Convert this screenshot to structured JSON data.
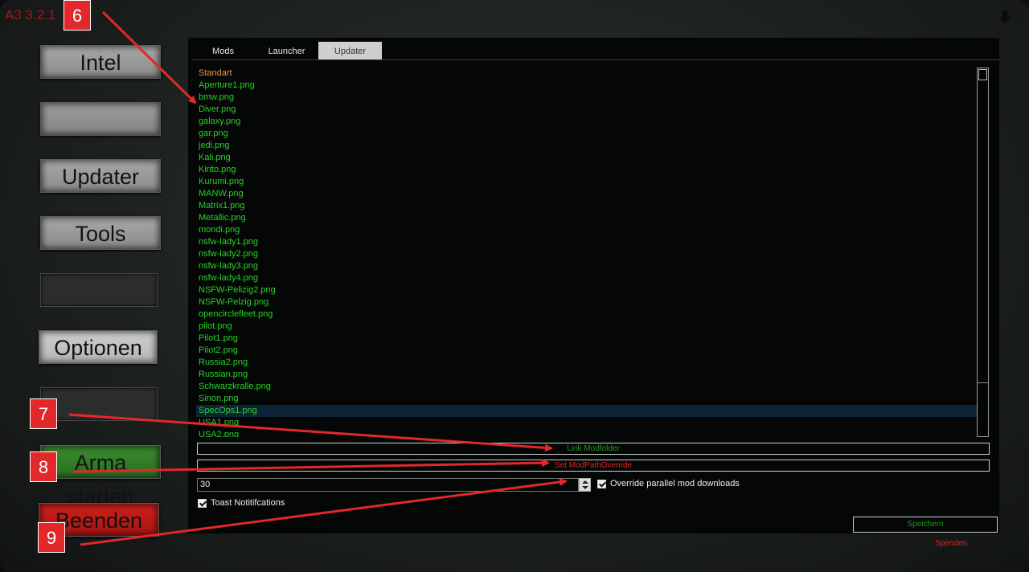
{
  "window": {
    "version": "A3 3.2.1"
  },
  "sidebar": {
    "buttons": [
      {
        "label": "Intel"
      },
      {
        "label": ""
      },
      {
        "label": "Updater"
      },
      {
        "label": "Tools"
      },
      {
        "label": ""
      },
      {
        "label": "Optionen"
      },
      {
        "label": ""
      },
      {
        "label": "Arma starten"
      },
      {
        "label": "Beenden"
      }
    ]
  },
  "tabs": [
    {
      "label": "Mods"
    },
    {
      "label": "Launcher"
    },
    {
      "label": "Updater"
    }
  ],
  "active_tab": "Updater",
  "file_list": [
    "Standart",
    "Aperture1.png",
    "bmw.png",
    "Diver.png",
    "galaxy.png",
    "gar.png",
    "jedi.png",
    "Kali.png",
    "Kirito.png",
    "Kurumi.png",
    "MANW.png",
    "Matrix1.png",
    "Metallic.png",
    "mondi.png",
    "nsfw-lady1.png",
    "nsfw-lady2.png",
    "nsfw-lady3.png",
    "nsfw-lady4.png",
    "NSFW-Pelizig2.png",
    "NSFW-Pelzig.png",
    "opencirclefleet.png",
    "pilot.png",
    "Pilot1.png",
    "Pilot2.png",
    "Russia2.png",
    "Russian.png",
    "Schwarzkralle.png",
    "Sinon.png",
    "SpecOps1.png",
    "USA1.png",
    "USA2.png"
  ],
  "selected_item": "SpecOps1.png",
  "settings": {
    "link_modfolder_label": "Link Modfolder",
    "set_modpath_label": "Set ModPathOverride",
    "parallel_value": "30",
    "override_parallel_label": "Override parallel mod downloads",
    "override_parallel_checked": true,
    "toast_label": "Toast Notitifcations",
    "toast_checked": true,
    "save_label": "Speichern",
    "donate_label": "Spenden"
  },
  "annotations": [
    {
      "number": "6"
    },
    {
      "number": "7"
    },
    {
      "number": "8"
    },
    {
      "number": "9"
    }
  ],
  "colors": {
    "list_text": "#25d325",
    "list_first": "#e89a3a",
    "link_text": "#1d9a1d",
    "override_text": "#e0261e",
    "callout": "#e2282a"
  },
  "icons": {
    "download": "download-arrow-icon"
  }
}
